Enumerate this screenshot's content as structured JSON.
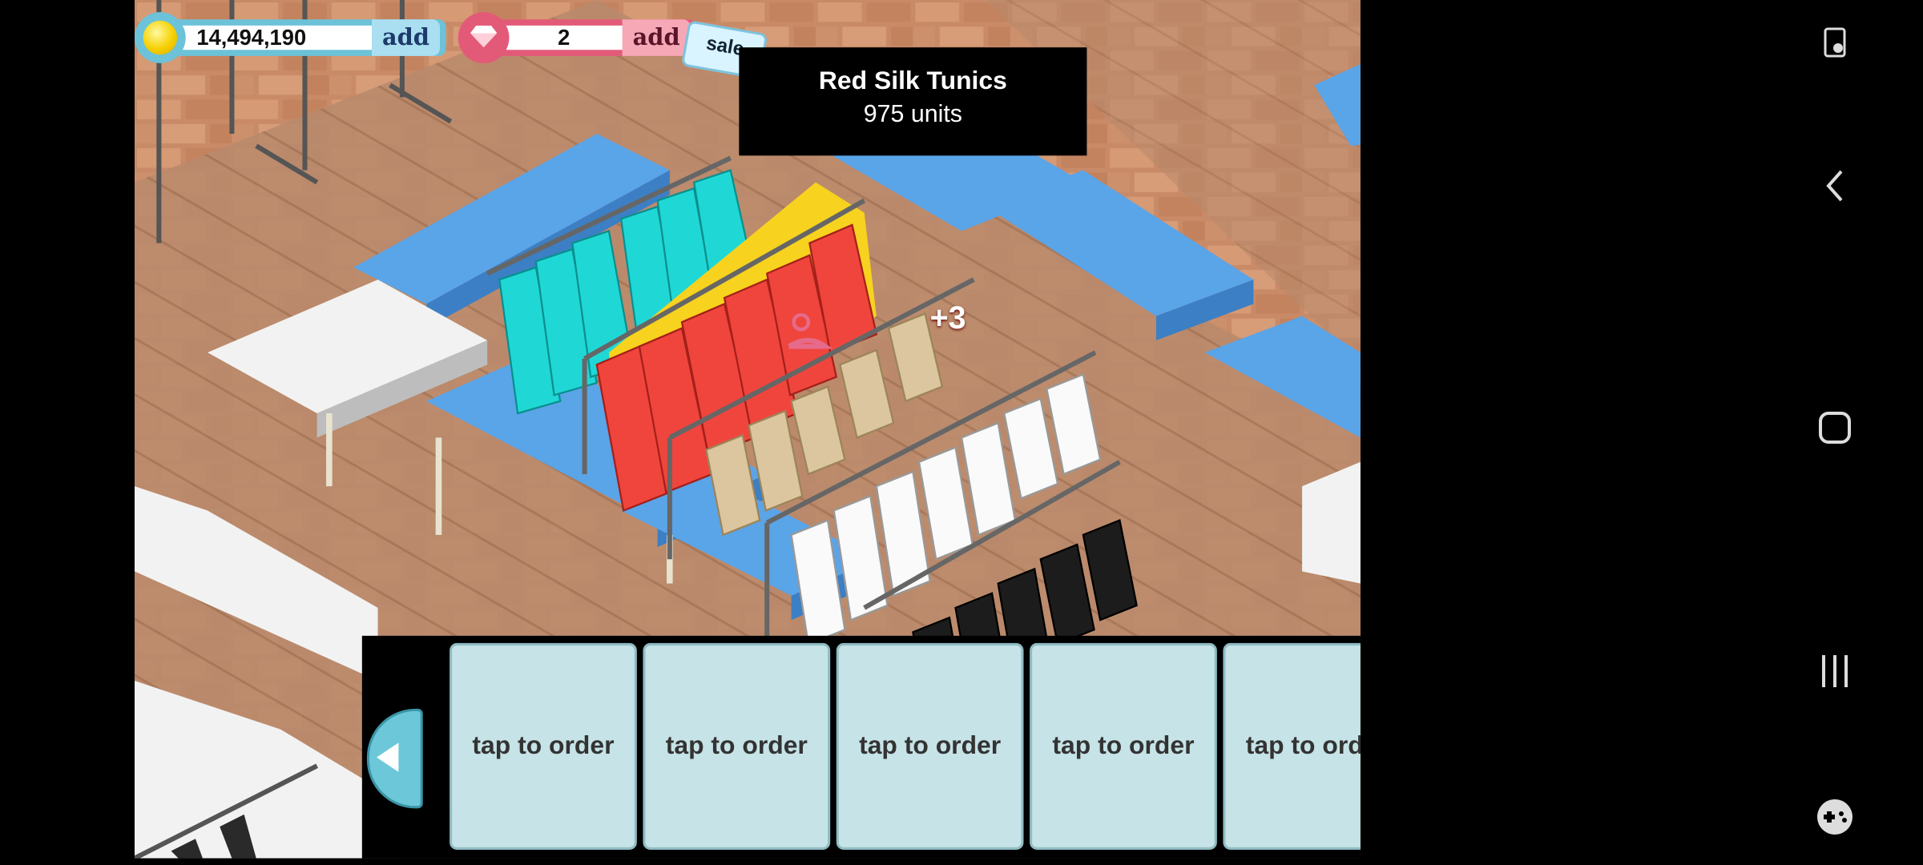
{
  "hud": {
    "coins": "14,494,190",
    "coin_add": "add",
    "gems": "2",
    "gem_add": "add",
    "sale_tag": "sale"
  },
  "tooltip": {
    "title": "Red Silk Tunics",
    "subtitle": "975 units"
  },
  "bonus": "+3",
  "tray": {
    "slots": [
      "tap to order",
      "tap to order",
      "tap to order",
      "tap to order",
      "tap to order"
    ],
    "close": "X"
  },
  "colors": {
    "floor": "#c8896a",
    "table_blue": "#5aa4e8",
    "table_white": "#f2f2f2",
    "aqua_tunic": "#1fd8d6",
    "red_tunic": "#f0453c",
    "tan_item": "#dcc6a0",
    "white_item": "#fafafa",
    "black_item": "#1c1c1c"
  },
  "nav": {
    "icons": [
      "screen-lock-icon",
      "back-icon",
      "home-icon",
      "recent-apps-icon",
      "game-launcher-icon"
    ]
  }
}
